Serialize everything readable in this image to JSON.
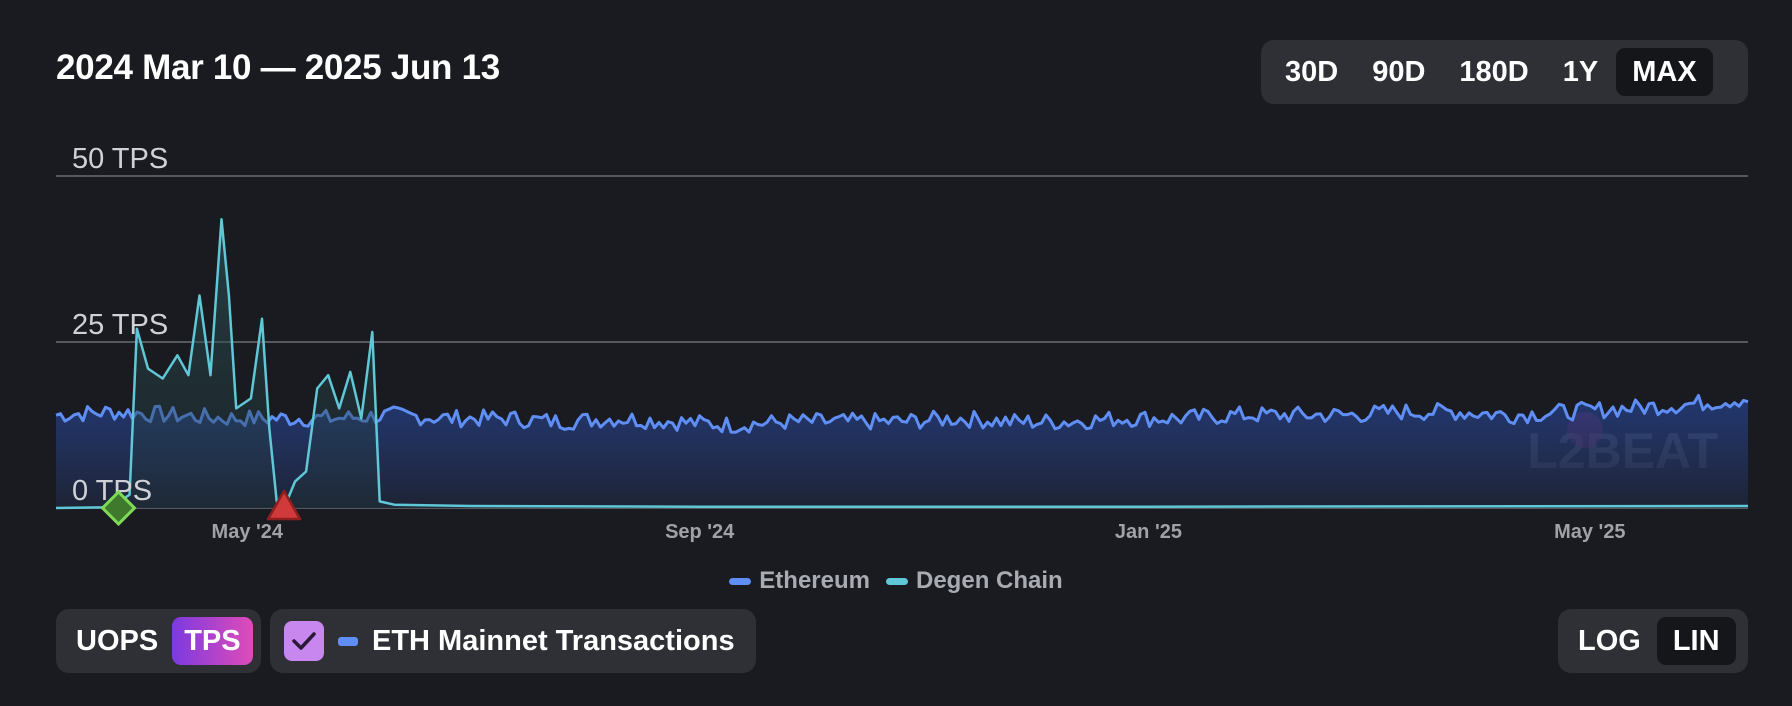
{
  "header": {
    "date_range": "2024 Mar 10 — 2025 Jun 13",
    "range_options": [
      "30D",
      "90D",
      "180D",
      "1Y",
      "MAX"
    ],
    "range_selected": "MAX"
  },
  "chart_data": {
    "type": "area",
    "y_unit": "TPS",
    "ylim": [
      0,
      50
    ],
    "y_ticks": [
      {
        "value": 50,
        "label": "50 TPS"
      },
      {
        "value": 25,
        "label": "25 TPS"
      },
      {
        "value": 0,
        "label": "0 TPS"
      }
    ],
    "x_start": "2024-03-10",
    "x_end": "2025-06-13",
    "x_ticks": [
      {
        "date": "2024-05-01",
        "label": "May '24"
      },
      {
        "date": "2024-09-01",
        "label": "Sep '24"
      },
      {
        "date": "2025-01-01",
        "label": "Jan '25"
      },
      {
        "date": "2025-05-01",
        "label": "May '25"
      }
    ],
    "grid": true,
    "legend_position": "bottom",
    "series": [
      {
        "name": "Ethereum",
        "color": "#5f8ff5",
        "points": [
          [
            "2024-03-10",
            14.0
          ],
          [
            "2024-03-25",
            14.5
          ],
          [
            "2024-04-10",
            14.0
          ],
          [
            "2024-04-25",
            13.5
          ],
          [
            "2024-05-10",
            13.5
          ],
          [
            "2024-05-25",
            13.5
          ],
          [
            "2024-06-10",
            14.0
          ],
          [
            "2024-06-25",
            13.5
          ],
          [
            "2024-07-10",
            13.5
          ],
          [
            "2024-07-25",
            13.0
          ],
          [
            "2024-08-10",
            13.5
          ],
          [
            "2024-08-25",
            13.0
          ],
          [
            "2024-09-10",
            12.5
          ],
          [
            "2024-09-25",
            13.0
          ],
          [
            "2024-10-10",
            13.0
          ],
          [
            "2024-10-25",
            13.0
          ],
          [
            "2024-11-10",
            13.5
          ],
          [
            "2024-11-25",
            13.0
          ],
          [
            "2024-12-10",
            13.0
          ],
          [
            "2024-12-25",
            13.5
          ],
          [
            "2025-01-10",
            13.5
          ],
          [
            "2025-01-25",
            14.0
          ],
          [
            "2025-02-10",
            14.0
          ],
          [
            "2025-02-25",
            14.0
          ],
          [
            "2025-03-10",
            14.5
          ],
          [
            "2025-03-25",
            14.5
          ],
          [
            "2025-04-10",
            14.0
          ],
          [
            "2025-04-25",
            14.5
          ],
          [
            "2025-05-10",
            15.0
          ],
          [
            "2025-05-25",
            15.5
          ],
          [
            "2025-06-13",
            16.5
          ]
        ]
      },
      {
        "name": "Degen Chain",
        "color": "#5fc7d5",
        "points": [
          [
            "2024-03-10",
            0.0
          ],
          [
            "2024-03-25",
            0.1
          ],
          [
            "2024-03-30",
            2.0
          ],
          [
            "2024-04-01",
            27.0
          ],
          [
            "2024-04-04",
            21.0
          ],
          [
            "2024-04-08",
            19.5
          ],
          [
            "2024-04-12",
            23.0
          ],
          [
            "2024-04-15",
            20.0
          ],
          [
            "2024-04-18",
            32.0
          ],
          [
            "2024-04-21",
            20.0
          ],
          [
            "2024-04-24",
            43.5
          ],
          [
            "2024-04-26",
            32.0
          ],
          [
            "2024-04-28",
            15.0
          ],
          [
            "2024-05-02",
            16.5
          ],
          [
            "2024-05-05",
            28.5
          ],
          [
            "2024-05-07",
            12.0
          ],
          [
            "2024-05-09",
            1.0
          ],
          [
            "2024-05-11",
            0.0
          ],
          [
            "2024-05-14",
            4.0
          ],
          [
            "2024-05-17",
            5.5
          ],
          [
            "2024-05-20",
            18.0
          ],
          [
            "2024-05-23",
            20.0
          ],
          [
            "2024-05-26",
            15.0
          ],
          [
            "2024-05-29",
            20.5
          ],
          [
            "2024-06-01",
            13.5
          ],
          [
            "2024-06-04",
            26.5
          ],
          [
            "2024-06-06",
            1.0
          ],
          [
            "2024-06-10",
            0.5
          ],
          [
            "2024-07-01",
            0.3
          ],
          [
            "2024-09-01",
            0.2
          ],
          [
            "2025-01-01",
            0.2
          ],
          [
            "2025-06-13",
            0.3
          ]
        ]
      }
    ],
    "annotations": [
      {
        "date": "2024-03-27",
        "marker": "diamond",
        "color": "#7ed957"
      },
      {
        "date": "2024-05-11",
        "marker": "triangle",
        "color": "#d03a3a"
      }
    ]
  },
  "watermark": "L2BEAT",
  "controls": {
    "mode_options": [
      "UOPS",
      "TPS"
    ],
    "mode_selected": "TPS",
    "eth_toggle_label": "ETH Mainnet Transactions",
    "eth_toggle_checked": true,
    "scale_options": [
      "LOG",
      "LIN"
    ],
    "scale_selected": "LIN"
  }
}
